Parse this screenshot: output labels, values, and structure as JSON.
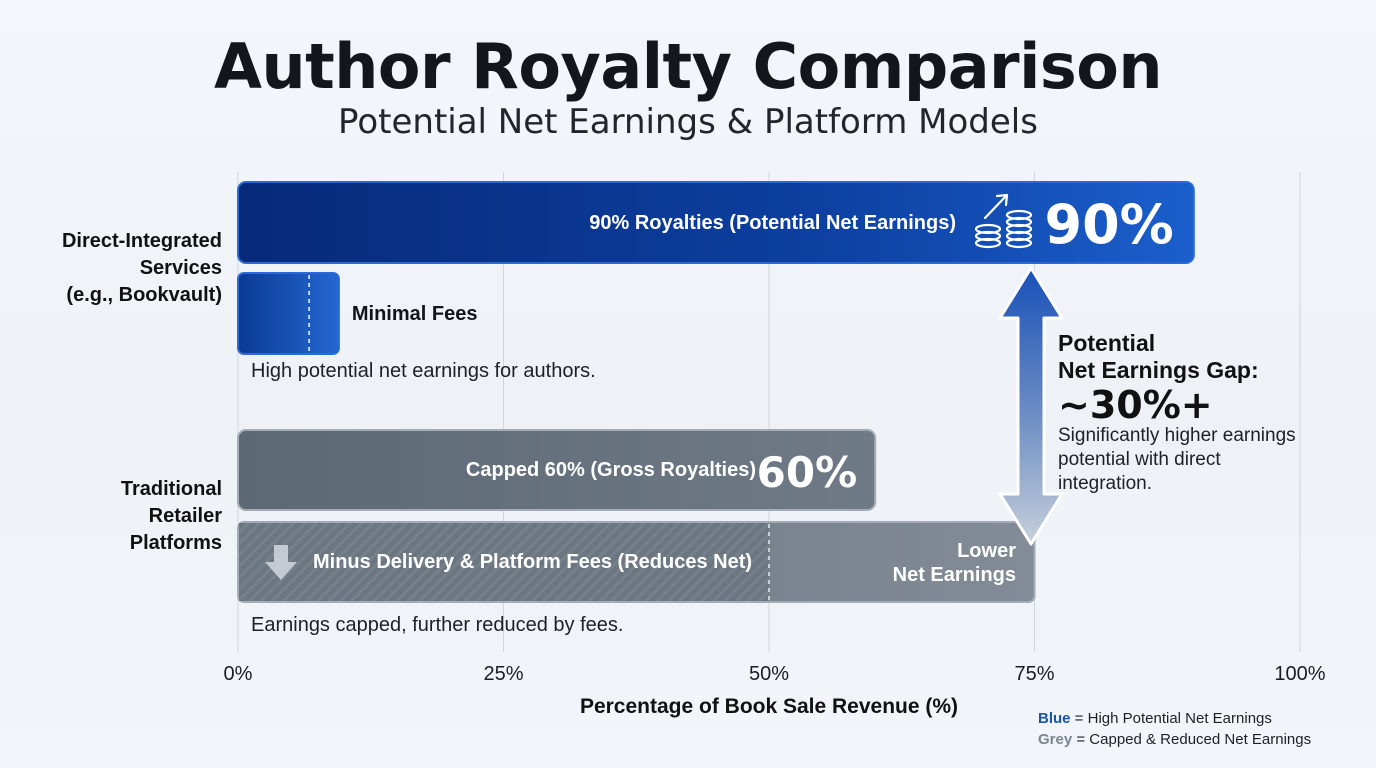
{
  "title": "Author Royalty Comparison",
  "subtitle": "Potential Net Earnings & Platform Models",
  "chart_data": {
    "type": "bar",
    "orientation": "horizontal",
    "xlabel": "Percentage of Book Sale Revenue (%)",
    "xlim": [
      0,
      100
    ],
    "x_ticks": [
      "0%",
      "25%",
      "50%",
      "75%",
      "100%"
    ],
    "tick_values": [
      0,
      25,
      50,
      75,
      100
    ],
    "grid": true,
    "categories": [
      {
        "label": "Direct-Integrated\nServices\n(e.g., Bookvault)",
        "note": "High potential net earnings for authors.",
        "bars": [
          {
            "label": "90% Royalties (Potential Net Earnings)",
            "value": 90,
            "value_label": "90%",
            "color": "#0d3f9e"
          },
          {
            "label": "Minimal Fees",
            "value": 9.5,
            "fee_marker": 6.7,
            "color": "#1d57c2"
          }
        ]
      },
      {
        "label": "Traditional\nRetailer\nPlatforms",
        "note": "Earnings capped, further reduced by fees.",
        "bars": [
          {
            "label": "Capped 60% (Gross Royalties)",
            "value": 60,
            "value_label": "60%",
            "color": "#67727f"
          },
          {
            "label": "Minus Delivery & Platform Fees (Reduces Net)",
            "value": 75,
            "fee_marker": 50,
            "end_label": "Lower\nNet Earnings",
            "color": "#7b8592"
          }
        ]
      }
    ],
    "annotations": {
      "gap_title": "Potential\nNet Earnings Gap:",
      "gap_value": "~30%+",
      "gap_description": "Significantly higher earnings potential with direct integration."
    },
    "legend": {
      "position": "bottom-right",
      "items": [
        {
          "key": "Blue",
          "text": " = High Potential Net Earnings",
          "color": "#1a55a8"
        },
        {
          "key": "Grey",
          "text": " = Capped & Reduced Net Earnings",
          "color": "#7d8691"
        }
      ]
    }
  }
}
